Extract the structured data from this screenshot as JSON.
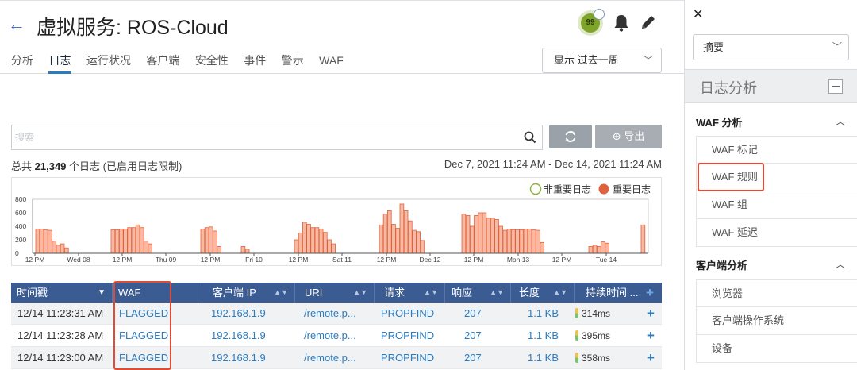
{
  "header": {
    "back_icon": "arrow-left-icon",
    "title": "虚拟服务: ROS-Cloud",
    "health_score": "99",
    "tabs": [
      {
        "label": "分析",
        "active": false
      },
      {
        "label": "日志",
        "active": true
      },
      {
        "label": "运行状况",
        "active": false
      },
      {
        "label": "客户端",
        "active": false
      },
      {
        "label": "安全性",
        "active": false
      },
      {
        "label": "事件",
        "active": false
      },
      {
        "label": "警示",
        "active": false
      },
      {
        "label": "WAF",
        "active": false
      }
    ],
    "period_label": "显示 过去一周"
  },
  "search": {
    "placeholder": "搜索",
    "export_label": "导出"
  },
  "summary": {
    "total_prefix": "总共",
    "total_count": "21,349",
    "total_suffix": "个日志 (已启用日志限制)",
    "date_range": "Dec 7, 2021 11:24 AM - Dec 14, 2021 11:24 AM"
  },
  "legend": {
    "non_significant": "非重要日志",
    "significant": "重要日志"
  },
  "colors": {
    "bar_fill": "#f7b9a2",
    "bar_stroke": "#e0613d",
    "accent_blue": "#2b7bbf",
    "table_header": "#3b5b93",
    "highlight_red": "#e24b33"
  },
  "chart_data": {
    "type": "bar",
    "title": "",
    "xlabel": "",
    "ylabel": "",
    "ylim": [
      0,
      800
    ],
    "yticks": [
      "800",
      "600",
      "400",
      "200",
      "0"
    ],
    "xticks": [
      "12 PM",
      "Wed 08",
      "12 PM",
      "Thu 09",
      "12 PM",
      "Fri 10",
      "12 PM",
      "Sat 11",
      "12 PM",
      "Dec 12",
      "12 PM",
      "Mon 13",
      "12 PM",
      "Tue 14"
    ],
    "series": [
      {
        "name": "重要日志",
        "clusters": [
          {
            "values": [
              360,
              360,
              350,
              340,
              180,
              120,
              140,
              80
            ]
          },
          {
            "values": [
              350,
              350,
              360,
              360,
              380,
              380,
              420,
              380,
              180,
              140
            ]
          },
          {
            "values": [
              360,
              380,
              390,
              330,
              100
            ]
          },
          {
            "values": [
              100,
              60
            ]
          },
          {
            "values": [
              200,
              300,
              460,
              430,
              380,
              380,
              360,
              310,
              200,
              140
            ]
          },
          {
            "values": [
              420,
              580,
              630,
              430,
              370,
              730,
              630,
              480,
              340,
              320,
              190
            ]
          },
          {
            "values": [
              580,
              560,
              400,
              560,
              600,
              600,
              520,
              520,
              500,
              400,
              340,
              360,
              350,
              350,
              350,
              360,
              360,
              350,
              340,
              160
            ]
          },
          {
            "values": [
              100,
              120,
              100,
              170,
              150
            ]
          },
          {
            "values": [
              420
            ]
          }
        ]
      }
    ]
  },
  "table": {
    "columns": [
      "时间戳",
      "WAF",
      "客户端 IP",
      "URI",
      "请求",
      "响应",
      "长度",
      "持续时间 ..."
    ],
    "rows": [
      {
        "time": "12/14 11:23:31 AM",
        "waf": "FLAGGED",
        "ip": "192.168.1.9",
        "uri": "/remote.p...",
        "req": "PROPFIND",
        "resp": "207",
        "len": "1.1 KB",
        "dur": "314ms"
      },
      {
        "time": "12/14 11:23:28 AM",
        "waf": "FLAGGED",
        "ip": "192.168.1.9",
        "uri": "/remote.p...",
        "req": "PROPFIND",
        "resp": "207",
        "len": "1.1 KB",
        "dur": "395ms"
      },
      {
        "time": "12/14 11:23:00 AM",
        "waf": "FLAGGED",
        "ip": "192.168.1.9",
        "uri": "/remote.p...",
        "req": "PROPFIND",
        "resp": "207",
        "len": "1.1 KB",
        "dur": "358ms"
      }
    ]
  },
  "panel": {
    "select_value": "摘要",
    "log_analysis_title": "日志分析",
    "waf_section": {
      "title": "WAF 分析",
      "items": [
        "WAF 标记",
        "WAF 规则",
        "WAF 组",
        "WAF 延迟"
      ]
    },
    "client_section": {
      "title": "客户端分析",
      "items": [
        "浏览器",
        "客户端操作系统",
        "设备"
      ]
    }
  }
}
